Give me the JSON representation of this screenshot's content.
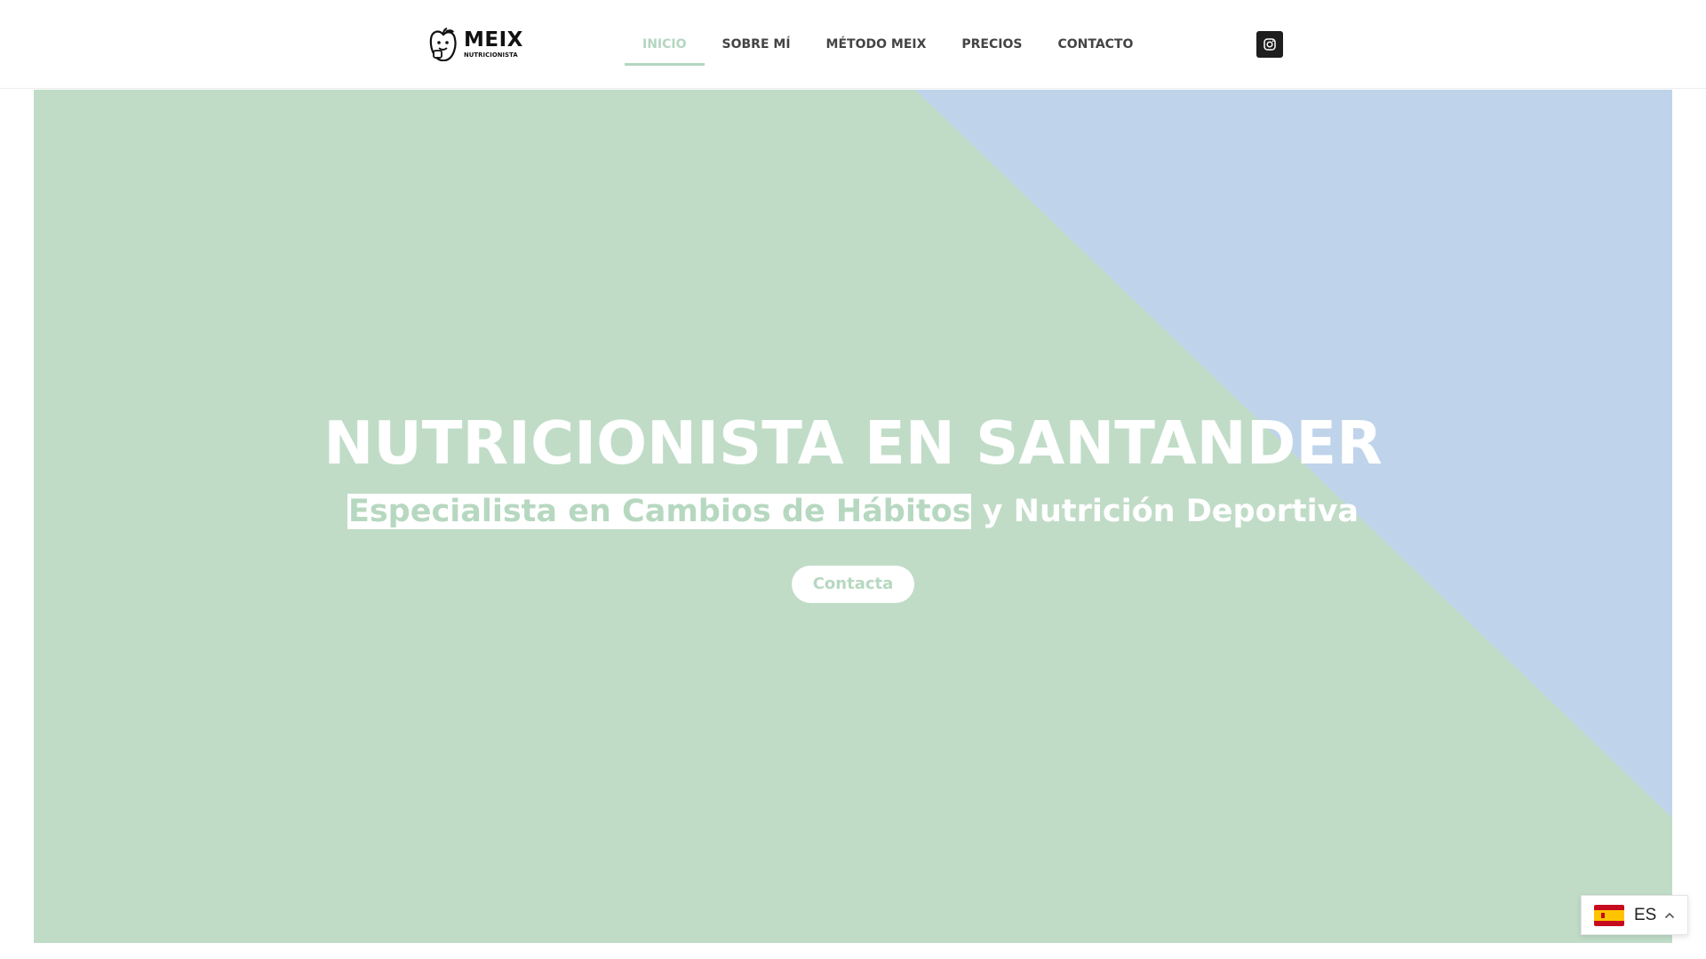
{
  "header": {
    "logo": {
      "name": "MEIX",
      "tagline": "NUTRICIONISTA",
      "icon": "apple-mascot-icon"
    },
    "nav": {
      "items": [
        {
          "label": "INICIO",
          "active": true
        },
        {
          "label": "SOBRE MÍ",
          "active": false
        },
        {
          "label": "MÉTODO MEIX",
          "active": false
        },
        {
          "label": "PRECIOS",
          "active": false
        },
        {
          "label": "CONTACTO",
          "active": false
        }
      ]
    },
    "social": {
      "icon": "instagram-icon"
    }
  },
  "hero": {
    "title": "NUTRICIONISTA EN SANTANDER",
    "subtitle_highlight": "Especialista en Cambios de Hábitos",
    "subtitle_rest": " y Nutrición Deportiva",
    "cta_label": "Contacta"
  },
  "language_switcher": {
    "code": "ES",
    "flag_icon": "spain-flag-icon",
    "chevron_icon": "chevron-up-icon"
  },
  "colors": {
    "hero_green": "#c0dcc7",
    "hero_blue": "#bfd4ea",
    "accent": "#b3d6c0",
    "nav_text": "#444444",
    "instagram_bg": "#1e1e1e"
  }
}
